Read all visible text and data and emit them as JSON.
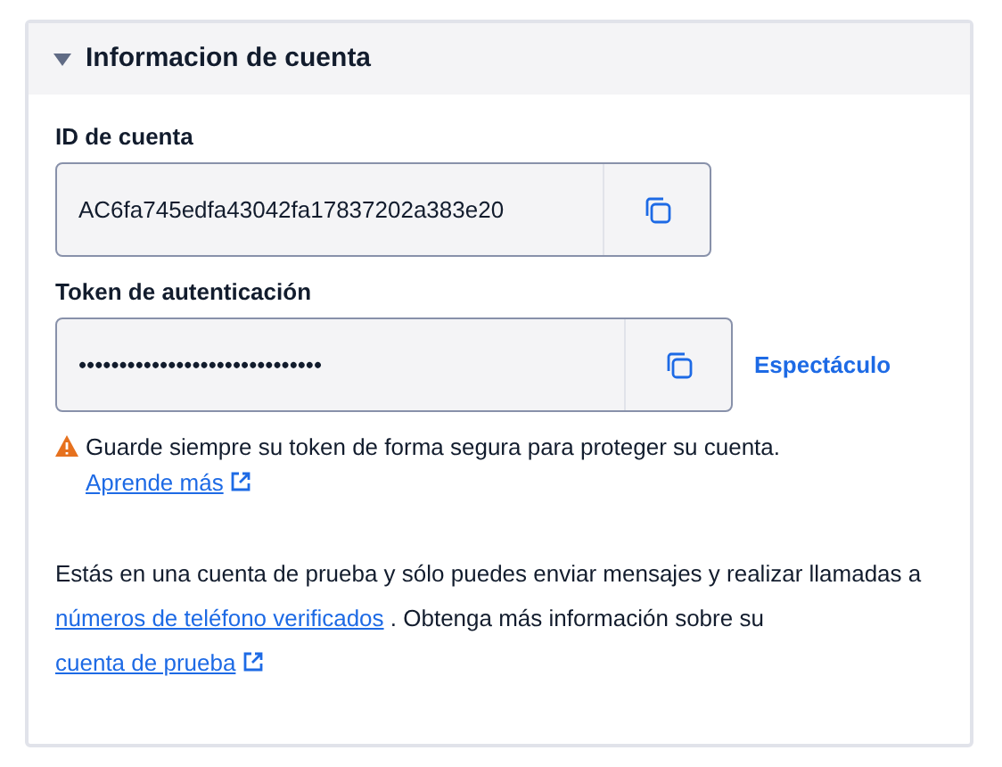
{
  "section": {
    "title": "Informacion de cuenta",
    "expanded": true
  },
  "fields": [
    {
      "label": "ID de cuenta",
      "value": "AC6fa745edfa43042fa17837202a383e20"
    },
    {
      "label": "Token de autenticación",
      "value": "••••••••••••••••••••••••••••••",
      "action": "Espectáculo"
    }
  ],
  "warning": {
    "text": "Guarde siempre su token de forma segura para proteger su cuenta.",
    "link": "Aprende más"
  },
  "note": [
    {
      "kind": "text",
      "text": "Estás en una cuenta de prueba y sólo puedes enviar mensajes y realizar llamadas a "
    },
    {
      "kind": "link",
      "text": "números de teléfono verificados"
    },
    {
      "kind": "text",
      "text": " . Obtenga más información sobre su "
    },
    {
      "kind": "external",
      "text": "cuenta de prueba"
    }
  ]
}
